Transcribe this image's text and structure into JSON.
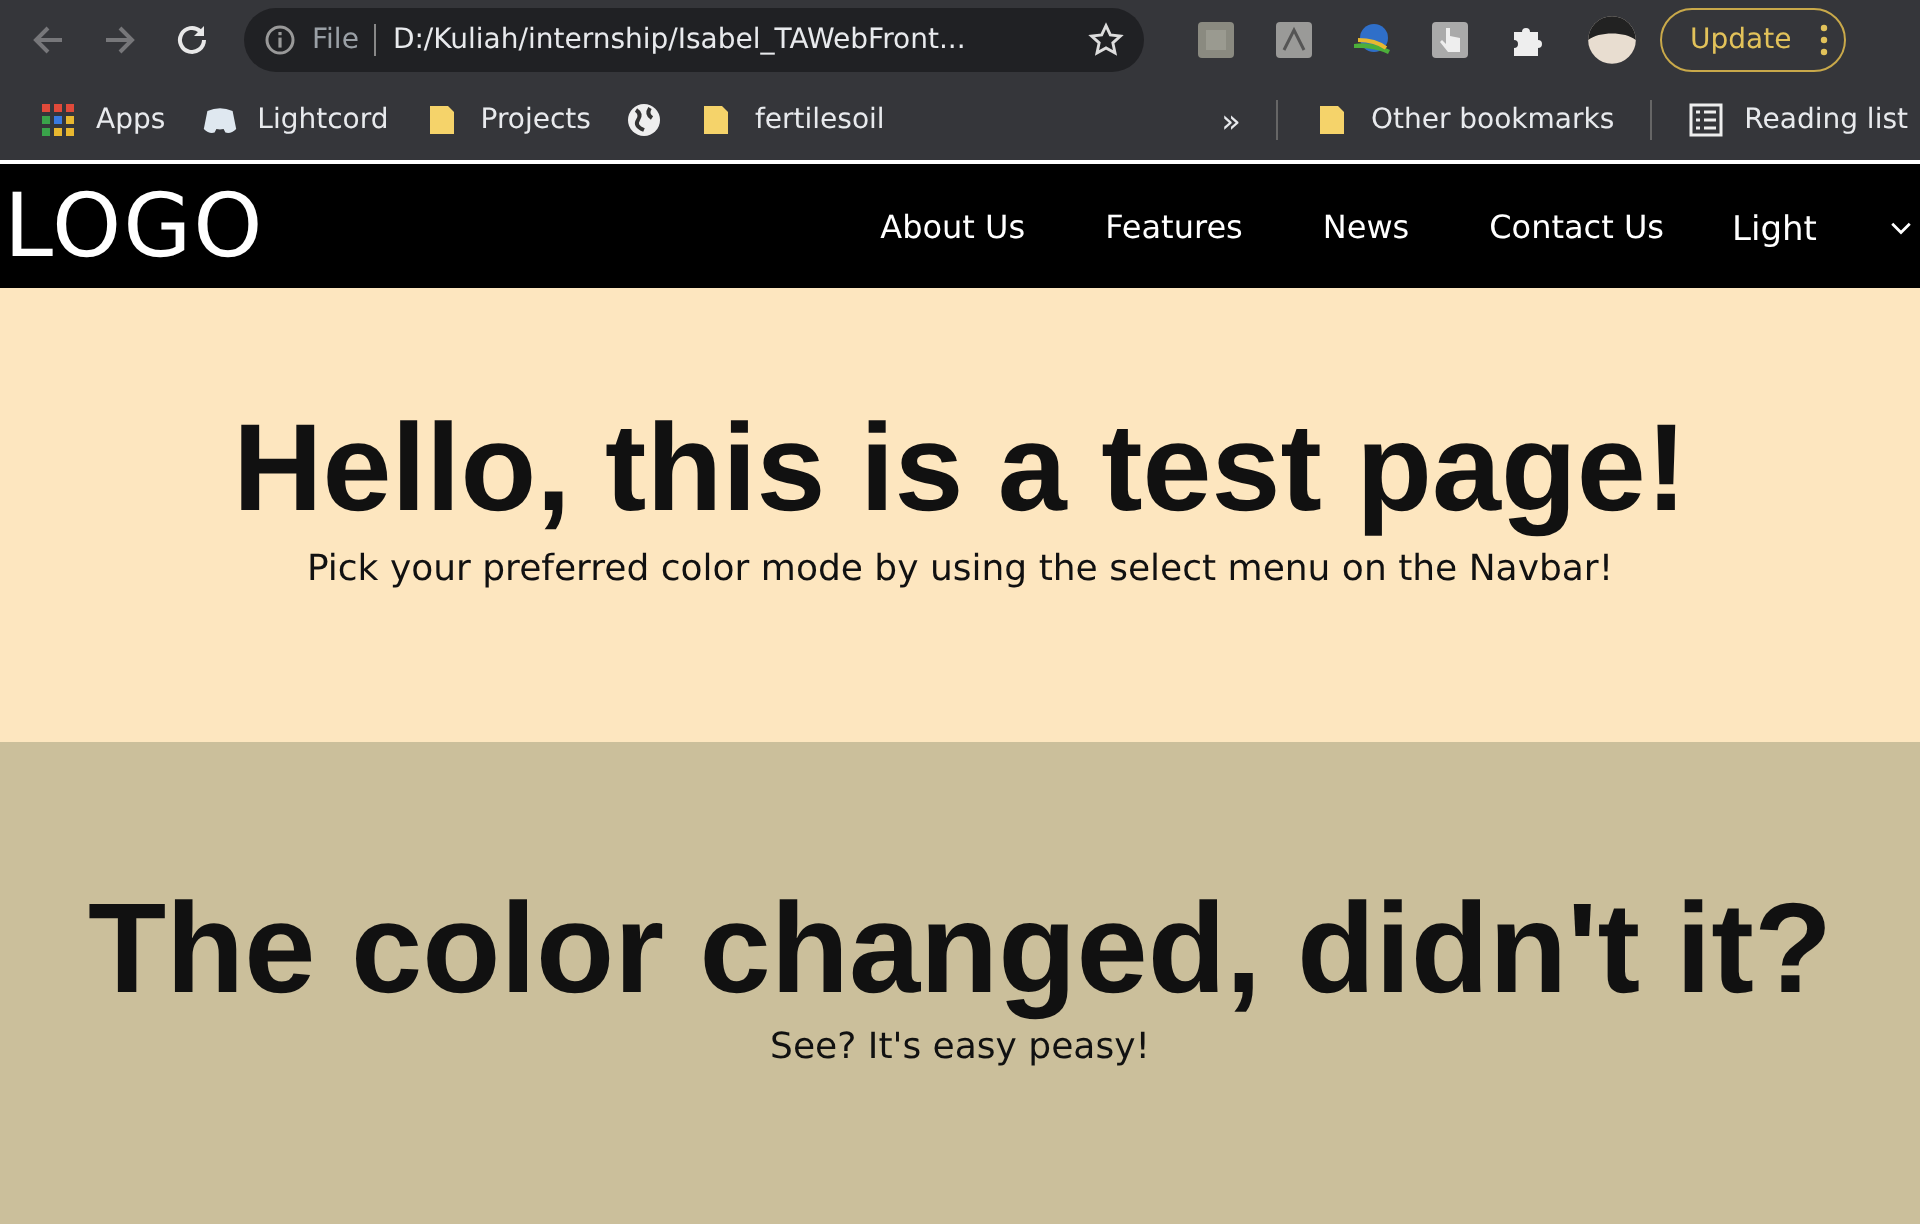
{
  "browser": {
    "nav_buttons": [
      {
        "kind": "back",
        "disabled": true
      },
      {
        "kind": "forward",
        "disabled": true
      },
      {
        "kind": "reload",
        "disabled": false
      }
    ],
    "address": {
      "scheme": "File",
      "url": "D:/Kuliah/internship/Isabel_TAWebFront..."
    },
    "extensions": [
      {
        "kind": "square"
      },
      {
        "kind": "pdf"
      },
      {
        "kind": "globe"
      },
      {
        "kind": "hand"
      },
      {
        "kind": "puzzle"
      },
      {
        "kind": "avatar"
      }
    ],
    "update_button": "Update",
    "bookmarks": [
      {
        "kind": "apps",
        "label": "Apps"
      },
      {
        "kind": "chat",
        "label": "Lightcord"
      },
      {
        "kind": "folder",
        "label": "Projects"
      },
      {
        "kind": "globe"
      },
      {
        "kind": "folder",
        "label": "fertilesoil"
      }
    ],
    "overflow": "»",
    "other_bookmarks": "Other bookmarks",
    "reading_list": "Reading list"
  },
  "page": {
    "logo": "LOGO",
    "nav_links": [
      "About Us",
      "Features",
      "News",
      "Contact Us"
    ],
    "theme_select": {
      "value": "Light"
    },
    "sections": [
      {
        "heading": "Hello, this is a test page!",
        "text": "Pick your preferred color mode by using the select menu on the Navbar!",
        "color": "#fde6bf"
      },
      {
        "heading": "The color changed, didn't it?",
        "text": "See? It's easy peasy!",
        "color": "#cbbf9b"
      }
    ]
  }
}
